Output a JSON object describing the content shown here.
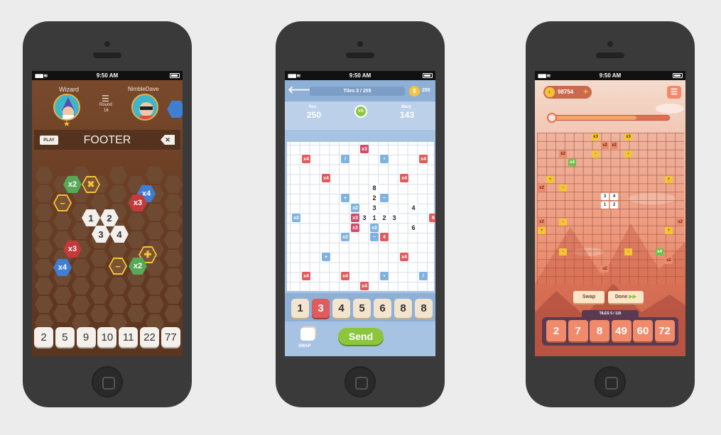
{
  "status": {
    "time": "9:50 AM"
  },
  "phone1": {
    "player1": "Wizard",
    "player2": "NimbleDave",
    "round_label": "Round",
    "round_value": "16",
    "play_label": "PLAY",
    "word": "FOOTER",
    "rack": [
      "2",
      "5",
      "9",
      "10",
      "11",
      "22",
      "77"
    ],
    "board_tiles": [
      {
        "t": "x2",
        "bg": "#58a957",
        "fg": "#fff"
      },
      {
        "t": "✖",
        "bg": "#7a5434",
        "fg": "#f4c437",
        "ring": "#f4c437"
      },
      {
        "t": "x4",
        "bg": "#3f7ed1",
        "fg": "#fff"
      },
      {
        "t": "−",
        "bg": "#7a5434",
        "fg": "#f4c437",
        "ring": "#f4c437"
      },
      {
        "t": "x3",
        "bg": "#c23a3a",
        "fg": "#fff"
      },
      {
        "t": "1",
        "bg": "#f2f0ec",
        "fg": "#333"
      },
      {
        "t": "2",
        "bg": "#f2f0ec",
        "fg": "#333"
      },
      {
        "t": "3",
        "bg": "#f2f0ec",
        "fg": "#333"
      },
      {
        "t": "4",
        "bg": "#f2f0ec",
        "fg": "#333"
      },
      {
        "t": "x3",
        "bg": "#c23a3a",
        "fg": "#fff"
      },
      {
        "t": "✚",
        "bg": "#7a5434",
        "fg": "#f4c437",
        "ring": "#f4c437"
      },
      {
        "t": "x4",
        "bg": "#3f7ed1",
        "fg": "#fff"
      },
      {
        "t": "−",
        "bg": "#7a5434",
        "fg": "#f4c437",
        "ring": "#f4c437"
      },
      {
        "t": "x2",
        "bg": "#58a957",
        "fg": "#fff"
      }
    ]
  },
  "phone2": {
    "tiles_label": "Tiles 3 / 255",
    "coins": "250",
    "you_label": "You",
    "you_score": "250",
    "vs": "VS",
    "opp_label": "Mary",
    "opp_score": "143",
    "rack": [
      "1",
      "3",
      "4",
      "5",
      "6",
      "8",
      "8"
    ],
    "swap_label": "SWAP",
    "send_label": "Send",
    "cells": [
      {
        "t": "x3",
        "k": "p"
      },
      {
        "t": "x4",
        "k": "r"
      },
      {
        "t": "/",
        "k": "b"
      },
      {
        "t": "•",
        "k": "b"
      },
      {
        "t": "x4",
        "k": "r"
      },
      {
        "t": "x4",
        "k": "r"
      },
      {
        "t": "x4",
        "k": "r"
      },
      {
        "t": "8",
        "k": "n"
      },
      {
        "t": "+",
        "k": "b"
      },
      {
        "t": "2",
        "k": "n"
      },
      {
        "t": "−",
        "k": "b"
      },
      {
        "t": "x2",
        "k": "b"
      },
      {
        "t": "3",
        "k": "n"
      },
      {
        "t": "4",
        "k": "n"
      },
      {
        "t": "x2",
        "k": "b"
      },
      {
        "t": "x3",
        "k": "p"
      },
      {
        "t": "3",
        "k": "n"
      },
      {
        "t": "1",
        "k": "n"
      },
      {
        "t": "2",
        "k": "n"
      },
      {
        "t": "3",
        "k": "n"
      },
      {
        "t": "6",
        "k": "r"
      },
      {
        "t": "x3",
        "k": "p"
      },
      {
        "t": "x2",
        "k": "b"
      },
      {
        "t": "6",
        "k": "n"
      },
      {
        "t": "x2",
        "k": "b"
      },
      {
        "t": "−",
        "k": "b"
      },
      {
        "t": "4",
        "k": "r"
      },
      {
        "t": "+",
        "k": "b"
      },
      {
        "t": "x4",
        "k": "r"
      },
      {
        "t": "x4",
        "k": "r"
      },
      {
        "t": "x4",
        "k": "r"
      },
      {
        "t": "•",
        "k": "b"
      },
      {
        "t": "/",
        "k": "b"
      },
      {
        "t": "x4",
        "k": "r"
      },
      {
        "t": "x3",
        "k": "p"
      }
    ]
  },
  "phone3": {
    "coins": "98754",
    "add": "+",
    "swap_label": "Swap",
    "done_label": "Done",
    "tiles_label": "TILES 5 / 120",
    "rack": [
      "2",
      "7",
      "8",
      "49",
      "60",
      "72"
    ],
    "cells": [
      {
        "t": "x3",
        "k": "y"
      },
      {
        "t": "x3",
        "k": "y"
      },
      {
        "t": "x2",
        "k": "o"
      },
      {
        "t": "x2",
        "k": "o"
      },
      {
        "t": "x2",
        "k": "o"
      },
      {
        "t": "-",
        "k": "y"
      },
      {
        "t": "-",
        "k": "y"
      },
      {
        "t": "x4",
        "k": "g"
      },
      {
        "t": "÷",
        "k": "y"
      },
      {
        "t": "÷",
        "k": "y"
      },
      {
        "t": "x2",
        "k": "o"
      },
      {
        "t": "-",
        "k": "y"
      },
      {
        "t": "3",
        "k": "w"
      },
      {
        "t": "4",
        "k": "w"
      },
      {
        "t": "1",
        "k": "w"
      },
      {
        "t": "2",
        "k": "w"
      },
      {
        "t": "x2",
        "k": "o"
      },
      {
        "t": "-",
        "k": "y"
      },
      {
        "t": "x2",
        "k": "o"
      },
      {
        "t": "÷",
        "k": "y"
      },
      {
        "t": "÷",
        "k": "y"
      },
      {
        "t": "-",
        "k": "y"
      },
      {
        "t": "-",
        "k": "y"
      },
      {
        "t": "x4",
        "k": "g"
      },
      {
        "t": "x2",
        "k": "o"
      },
      {
        "t": "x2",
        "k": "o"
      }
    ]
  }
}
